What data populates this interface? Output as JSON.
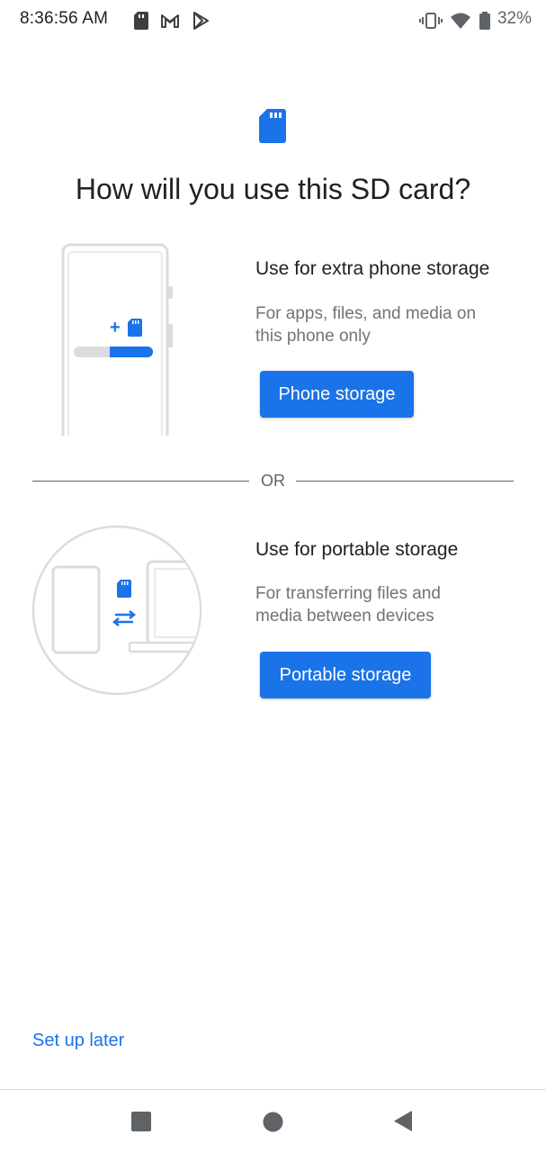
{
  "status_bar": {
    "time": "8:36:56 AM",
    "battery": "32%",
    "left_icons": [
      "sd-card-icon",
      "gmail-icon",
      "play-store-icon"
    ],
    "right_icons": [
      "vibrate-icon",
      "wifi-icon",
      "battery-icon"
    ]
  },
  "header": {
    "icon": "sd-card-icon",
    "title": "How will you use this SD card?"
  },
  "option_phone": {
    "title": "Use for extra phone storage",
    "description_line1": "For apps, files, and media on",
    "description_line2": "this phone only",
    "button_label": "Phone storage"
  },
  "divider": {
    "label": "OR"
  },
  "option_portable": {
    "title": "Use for portable storage",
    "description_line1": "For transferring files and",
    "description_line2": "media between devices",
    "button_label": "Portable storage"
  },
  "footer": {
    "setup_later": "Set up later"
  },
  "nav_bar": {
    "icons": [
      "recents-icon",
      "home-icon",
      "back-icon"
    ]
  },
  "colors": {
    "accent": "#1a73e8",
    "text": "#202124",
    "secondary_text": "#707378"
  }
}
